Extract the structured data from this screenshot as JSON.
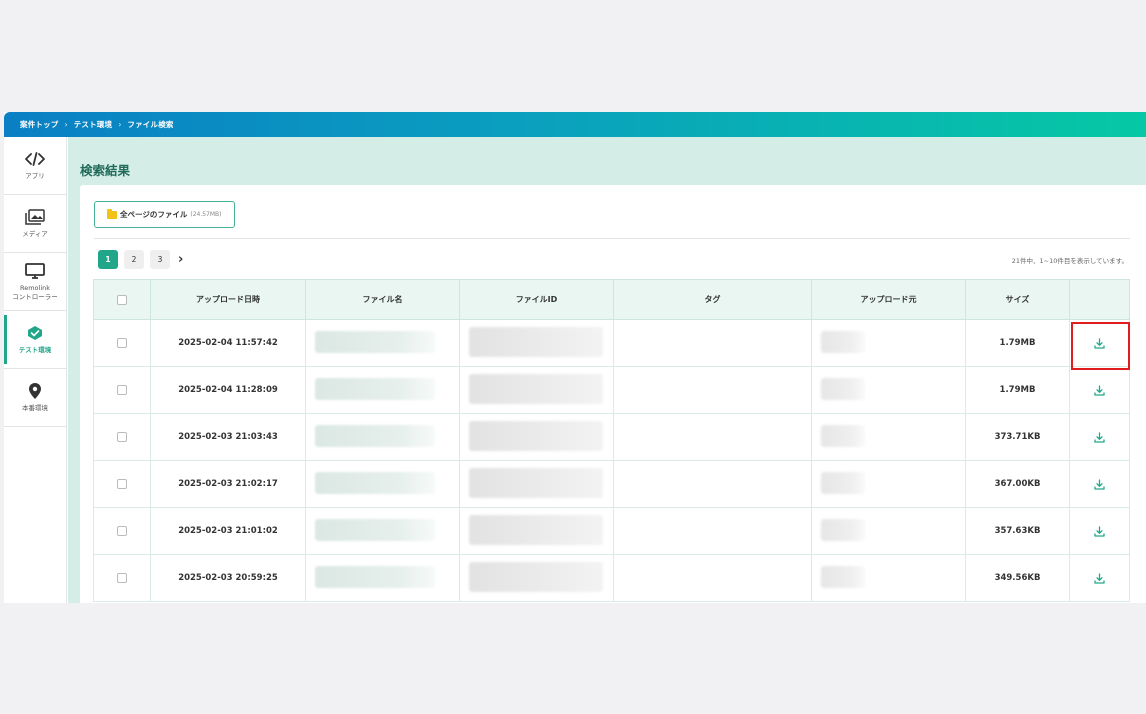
{
  "breadcrumb": [
    "案件トップ",
    "テスト環境",
    "ファイル検索"
  ],
  "sidebar": {
    "items": [
      {
        "label": "アプリ",
        "icon": "code-icon",
        "active": false
      },
      {
        "label": "メディア",
        "icon": "media-icon",
        "active": false
      },
      {
        "label": "Remolink\nコントローラー",
        "icon": "monitor-icon",
        "active": false
      },
      {
        "label": "テスト環境",
        "icon": "check-badge-icon",
        "active": true
      },
      {
        "label": "本番環境",
        "icon": "location-pin-icon",
        "active": false
      }
    ]
  },
  "main": {
    "title": "検索結果",
    "all_files_button": {
      "label": "全ページのファイル",
      "size": "(24.57MB)"
    },
    "pagination": {
      "pages": [
        "1",
        "2",
        "3"
      ],
      "current": "1"
    },
    "result_count": "21件中、1~10件目を表示しています。",
    "table": {
      "headers": [
        "アップロード日時",
        "ファイル名",
        "ファイルID",
        "タグ",
        "アップロード元",
        "サイズ"
      ],
      "rows": [
        {
          "datetime": "2025-02-04 11:57:42",
          "size": "1.79MB"
        },
        {
          "datetime": "2025-02-04 11:28:09",
          "size": "1.79MB"
        },
        {
          "datetime": "2025-02-03 21:03:43",
          "size": "373.71KB"
        },
        {
          "datetime": "2025-02-03 21:02:17",
          "size": "367.00KB"
        },
        {
          "datetime": "2025-02-03 21:01:02",
          "size": "357.63KB"
        },
        {
          "datetime": "2025-02-03 20:59:25",
          "size": "349.56KB"
        }
      ]
    }
  },
  "colors": {
    "accent": "#21a68a",
    "highlight": "#e01c1c"
  }
}
